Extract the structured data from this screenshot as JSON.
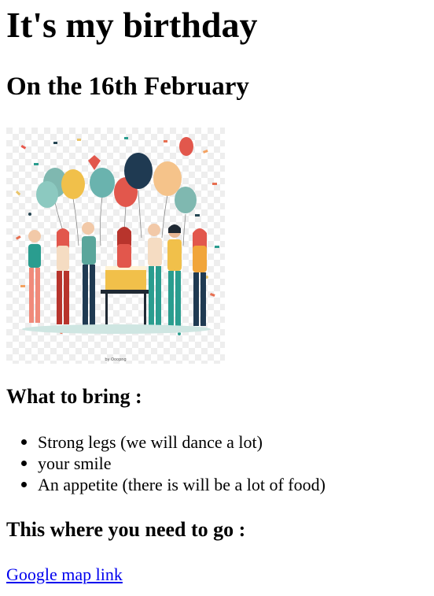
{
  "page": {
    "title": "It's my birthday",
    "subtitle": "On the 16th February",
    "image": {
      "alt": "birthday party illustration",
      "caption": "by Ooopng"
    },
    "bring_heading": "What to bring :",
    "bring_items": [
      "Strong legs (we will dance a lot)",
      "your smile",
      "An appetite (there is will be a lot of food)"
    ],
    "go_heading": "This where you need to go :",
    "map_link": "Google map link"
  },
  "colors": {
    "link": "#0000ee",
    "text": "#000000",
    "background": "#ffffff"
  }
}
